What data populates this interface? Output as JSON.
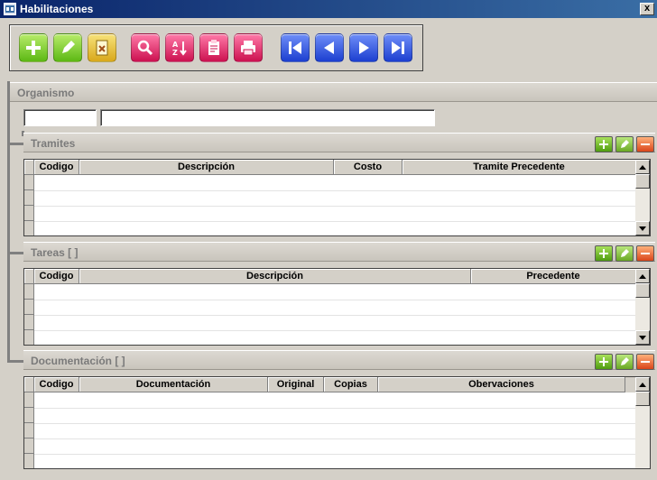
{
  "window": {
    "title": "Habilitaciones",
    "close_label": "x"
  },
  "toolbar": {
    "buttons": [
      {
        "name": "add-button",
        "icon": "plus-icon",
        "color": "green"
      },
      {
        "name": "edit-button",
        "icon": "pencil-icon",
        "color": "green"
      },
      {
        "name": "delete-button",
        "icon": "delete-document-icon",
        "color": "yellow"
      },
      {
        "name": "search-button",
        "icon": "magnifier-icon",
        "color": "pink"
      },
      {
        "name": "sort-button",
        "icon": "sort-az-icon",
        "color": "pink"
      },
      {
        "name": "report-button",
        "icon": "clipboard-icon",
        "color": "pink"
      },
      {
        "name": "print-button",
        "icon": "printer-icon",
        "color": "pink"
      },
      {
        "name": "first-record-button",
        "icon": "first-icon",
        "color": "blue"
      },
      {
        "name": "previous-record-button",
        "icon": "previous-icon",
        "color": "blue"
      },
      {
        "name": "next-record-button",
        "icon": "next-icon",
        "color": "blue"
      },
      {
        "name": "last-record-button",
        "icon": "last-icon",
        "color": "blue"
      }
    ]
  },
  "organismo": {
    "label": "Organismo",
    "code_value": "",
    "name_value": ""
  },
  "tramites": {
    "label": "Tramites",
    "columns": [
      "Codigo",
      "Descripción",
      "Costo",
      "Tramite Precedente"
    ],
    "rows": []
  },
  "tareas": {
    "label": "Tareas [ ]",
    "columns": [
      "Codigo",
      "Descripción",
      "Precedente"
    ],
    "rows": []
  },
  "documentacion": {
    "label": "Documentación [ ]",
    "columns": [
      "Codigo",
      "Documentación",
      "Original",
      "Copias",
      "Obervaciones"
    ],
    "rows": []
  },
  "colors": {
    "titlebar_start": "#0a246a",
    "titlebar_end": "#3a6ea5",
    "window_bg": "#d4d0c8"
  }
}
